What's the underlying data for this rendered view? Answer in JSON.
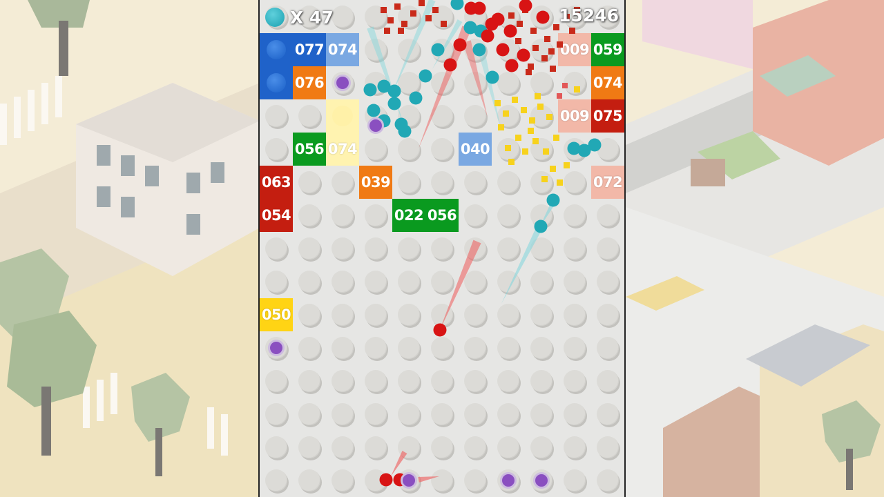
{
  "hud": {
    "ball_count": "X 47",
    "score": "15246"
  },
  "colors": {
    "board": "#e6e6e4",
    "shot_ball": "#21a8b5",
    "red_ball": "#d81414",
    "brick_green": "#0a9a1f",
    "brick_orange": "#f07a14",
    "brick_blue": "#1f62c9",
    "brick_light_blue": "#7aa8e2",
    "brick_red": "#c41e10",
    "brick_yellow": "#ffd414",
    "brick_pale_yellow": "#fff3b0",
    "brick_pale_red": "#f2b8a8",
    "powerup_purple": "#8a4fc0"
  },
  "bricks": [
    {
      "label": "077",
      "style": "blue"
    },
    {
      "label": "074",
      "style": "light-blue"
    },
    {
      "label": "009",
      "style": "pale-red"
    },
    {
      "label": "059",
      "style": "green"
    },
    {
      "label": "076",
      "style": "orange"
    },
    {
      "label": "074",
      "style": "orange"
    },
    {
      "label": "009",
      "style": "pale-red"
    },
    {
      "label": "075",
      "style": "red"
    },
    {
      "label": "056",
      "style": "green"
    },
    {
      "label": "074",
      "style": "pale-yellow"
    },
    {
      "label": "040",
      "style": "light-blue"
    },
    {
      "label": "063",
      "style": "red"
    },
    {
      "label": "039",
      "style": "orange"
    },
    {
      "label": "072",
      "style": "pale-red"
    },
    {
      "label": "054",
      "style": "red"
    },
    {
      "label": "022",
      "style": "green"
    },
    {
      "label": "056",
      "style": "green"
    },
    {
      "label": "050",
      "style": "yellow"
    }
  ],
  "powerups": [
    {
      "type": "extra-ball-blue-icon"
    },
    {
      "type": "extra-ball-blue-icon"
    },
    {
      "type": "purple-orb-icon"
    },
    {
      "type": "purple-orb-icon"
    },
    {
      "type": "purple-orb-icon"
    },
    {
      "type": "purple-orb-icon"
    },
    {
      "type": "purple-orb-icon"
    },
    {
      "type": "purple-orb-icon"
    },
    {
      "type": "yellow-glow-orb-icon"
    }
  ]
}
